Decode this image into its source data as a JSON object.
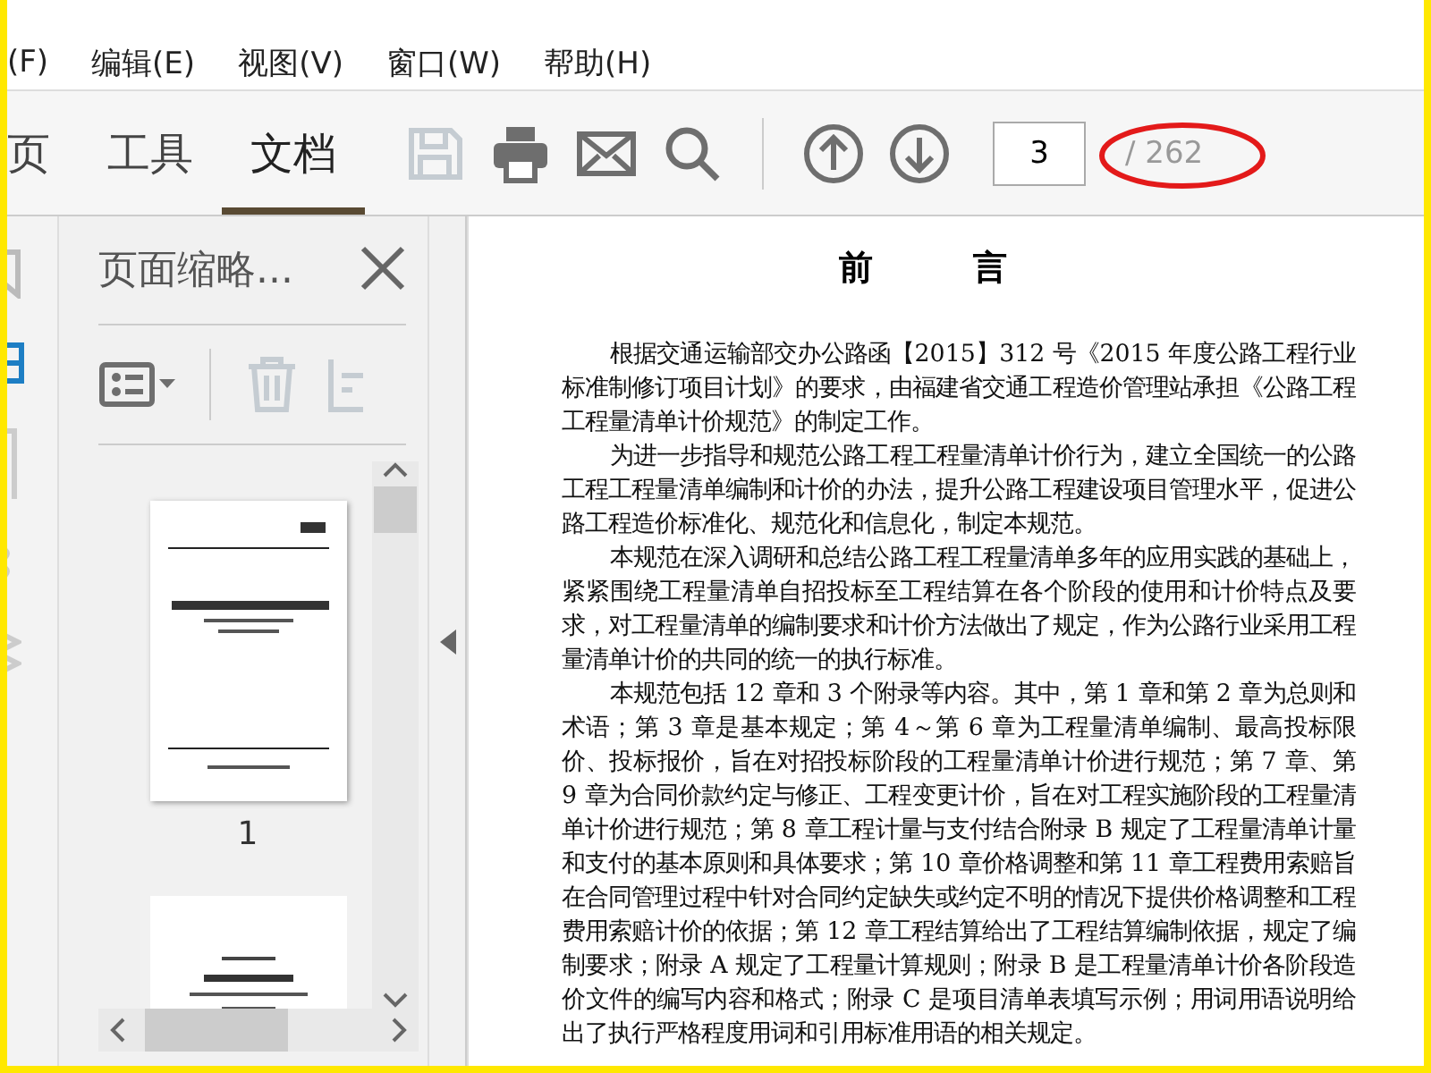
{
  "menu": [
    "(F)",
    "编辑(E)",
    "视图(V)",
    "窗口(W)",
    "帮助(H)"
  ],
  "tabs": [
    {
      "label": "页",
      "selected": false
    },
    {
      "label": "工具",
      "selected": false
    },
    {
      "label": "文档",
      "selected": true
    }
  ],
  "toolbar": {
    "save_disabled": true,
    "page_field": {
      "value": "3"
    },
    "page_total": "/ 262"
  },
  "panel": {
    "title": "页面缩略...",
    "thumbnail_labels": [
      "1"
    ]
  },
  "document": {
    "heading": "前 言",
    "paragraphs": [
      "根据交通运输部交办公路函【2015】312 号《2015 年度公路工程行业标准制修订项目计划》的要求，由福建省交通工程造价管理站承担《公路工程工程量清单计价规范》的制定工作。",
      "为进一步指导和规范公路工程工程量清单计价行为，建立全国统一的公路工程工程量清单编制和计价的办法，提升公路工程建设项目管理水平，促进公路工程造价标准化、规范化和信息化，制定本规范。",
      "本规范在深入调研和总结公路工程工程量清单多年的应用实践的基础上，紧紧围绕工程量清单自招投标至工程结算在各个阶段的使用和计价特点及要求，对工程量清单的编制要求和计价方法做出了规定，作为公路行业采用工程量清单计价的共同的统一的执行标准。",
      "本规范包括 12 章和 3 个附录等内容。其中，第 1 章和第 2 章为总则和术语；第 3 章是基本规定；第 4～第 6 章为工程量清单编制、最高投标限价、投标报价，旨在对招投标阶段的工程量清单计价进行规范；第 7 章、第 9 章为合同价款约定与修正、工程变更计价，旨在对工程实施阶段的工程量清单计价进行规范；第 8 章工程计量与支付结合附录 B 规定了工程量清单计量和支付的基本原则和具体要求；第 10 章价格调整和第 11 章工程费用索赔旨在合同管理过程中针对合同约定缺失或约定不明的情况下提供价格调整和工程费用索赔计价的依据；第 12 章工程结算给出了工程结算编制依据，规定了编制要求；附录 A 规定了工程量计算规则；附录 B 是工程量清单计价各阶段造价文件的编写内容和格式；附录 C 是项目清单表填写示例；用词用语说明给出了执行严格程度用词和引用标准用语的相关规定。"
    ]
  }
}
